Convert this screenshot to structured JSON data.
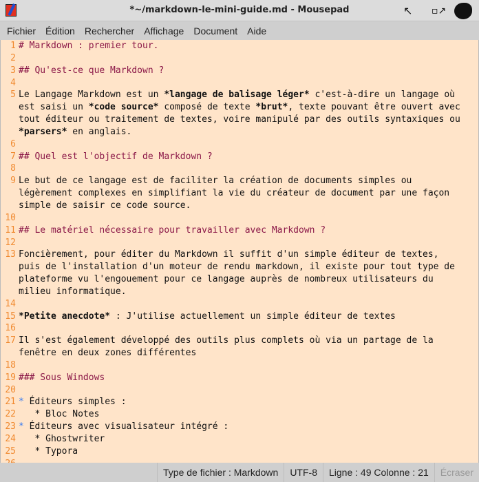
{
  "window": {
    "title": "*~/markdown-le-mini-guide.md - Mousepad"
  },
  "menu": [
    "Fichier",
    "Édition",
    "Rechercher",
    "Affichage",
    "Document",
    "Aide"
  ],
  "lines": [
    {
      "n": "1",
      "rows": [
        [
          {
            "t": "# Markdown : premier tour.",
            "s": "h"
          }
        ]
      ]
    },
    {
      "n": "2",
      "rows": [
        [
          {
            "t": ""
          }
        ]
      ]
    },
    {
      "n": "3",
      "rows": [
        [
          {
            "t": "## Qu'est-ce que Markdown ?",
            "s": "h"
          }
        ]
      ]
    },
    {
      "n": "4",
      "rows": [
        [
          {
            "t": ""
          }
        ]
      ]
    },
    {
      "n": "5",
      "rows": [
        [
          {
            "t": "Le Langage Markdown est un "
          },
          {
            "t": "*langage de balisage léger*",
            "s": "b"
          },
          {
            "t": " c'est-à-dire un langage où"
          }
        ],
        [
          {
            "t": "est saisi un "
          },
          {
            "t": "*code source*",
            "s": "b"
          },
          {
            "t": " composé de texte "
          },
          {
            "t": "*brut*",
            "s": "b"
          },
          {
            "t": ", texte pouvant être ouvert avec"
          }
        ],
        [
          {
            "t": "tout éditeur ou traitement de textes, voire manipulé par des outils syntaxiques ou"
          }
        ],
        [
          {
            "t": "*parsers*",
            "s": "b"
          },
          {
            "t": " en anglais."
          }
        ]
      ]
    },
    {
      "n": "6",
      "rows": [
        [
          {
            "t": ""
          }
        ]
      ]
    },
    {
      "n": "7",
      "rows": [
        [
          {
            "t": "## Quel est l'objectif de Markdown ?",
            "s": "h"
          }
        ]
      ]
    },
    {
      "n": "8",
      "rows": [
        [
          {
            "t": ""
          }
        ]
      ]
    },
    {
      "n": "9",
      "rows": [
        [
          {
            "t": "Le but de ce langage est de faciliter la création de documents simples ou"
          }
        ],
        [
          {
            "t": "légèrement complexes en simplifiant la vie du créateur de document par une façon"
          }
        ],
        [
          {
            "t": "simple de saisir ce code source."
          }
        ]
      ]
    },
    {
      "n": "10",
      "rows": [
        [
          {
            "t": ""
          }
        ]
      ]
    },
    {
      "n": "11",
      "rows": [
        [
          {
            "t": "## Le matériel nécessaire pour travailler avec Markdown ?",
            "s": "h"
          }
        ]
      ]
    },
    {
      "n": "12",
      "rows": [
        [
          {
            "t": ""
          }
        ]
      ]
    },
    {
      "n": "13",
      "rows": [
        [
          {
            "t": "Foncièrement, pour éditer du Markdown il suffit d'un simple éditeur de textes,"
          }
        ],
        [
          {
            "t": "puis de l'installation d'un moteur de rendu markdown, il existe pour tout type de"
          }
        ],
        [
          {
            "t": "plateforme vu l'engouement pour ce langage auprès de nombreux utilisateurs du"
          }
        ],
        [
          {
            "t": "milieu informatique."
          }
        ]
      ]
    },
    {
      "n": "14",
      "rows": [
        [
          {
            "t": ""
          }
        ]
      ]
    },
    {
      "n": "15",
      "rows": [
        [
          {
            "t": "*Petite anecdote*",
            "s": "b"
          },
          {
            "t": " : J'utilise actuellement un simple éditeur de textes"
          }
        ]
      ]
    },
    {
      "n": "16",
      "rows": [
        [
          {
            "t": ""
          }
        ]
      ]
    },
    {
      "n": "17",
      "rows": [
        [
          {
            "t": "Il s'est également développé des outils plus complets où via un partage de la"
          }
        ],
        [
          {
            "t": "fenêtre en deux zones différentes"
          }
        ]
      ]
    },
    {
      "n": "18",
      "rows": [
        [
          {
            "t": ""
          }
        ]
      ]
    },
    {
      "n": "19",
      "rows": [
        [
          {
            "t": "### Sous Windows",
            "s": "h"
          }
        ]
      ]
    },
    {
      "n": "20",
      "rows": [
        [
          {
            "t": ""
          }
        ]
      ]
    },
    {
      "n": "21",
      "rows": [
        [
          {
            "t": "*",
            "s": "bl"
          },
          {
            "t": " Éditeurs simples :"
          }
        ]
      ]
    },
    {
      "n": "22",
      "rows": [
        [
          {
            "t": "   * Bloc Notes"
          }
        ]
      ]
    },
    {
      "n": "23",
      "rows": [
        [
          {
            "t": "*",
            "s": "bl"
          },
          {
            "t": " Éditeurs avec visualisateur intégré :"
          }
        ]
      ]
    },
    {
      "n": "24",
      "rows": [
        [
          {
            "t": "   * Ghostwriter"
          }
        ]
      ]
    },
    {
      "n": "25",
      "rows": [
        [
          {
            "t": "   * Typora"
          }
        ]
      ]
    },
    {
      "n": "26",
      "rows": [
        [
          {
            "t": ""
          }
        ]
      ]
    }
  ],
  "status": {
    "filetype": "Type de fichier : Markdown",
    "encoding": "UTF-8",
    "position": "Ligne : 49 Colonne : 21",
    "mode": "Écraser"
  }
}
